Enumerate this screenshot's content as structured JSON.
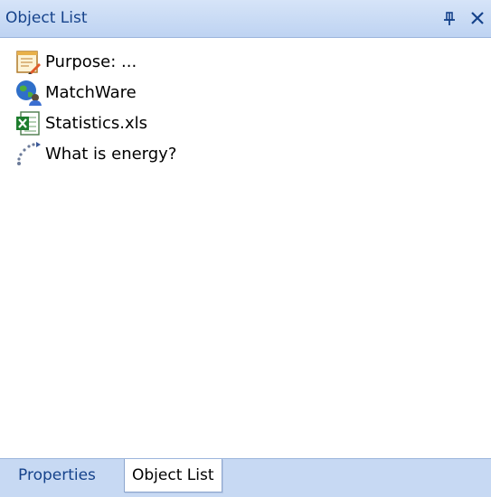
{
  "panel": {
    "title": "Object List",
    "pin_icon": "pin-icon",
    "close_icon": "close-icon"
  },
  "items": [
    {
      "label": "Purpose: ...",
      "icon": "form-document-icon"
    },
    {
      "label": "MatchWare",
      "icon": "globe-user-icon"
    },
    {
      "label": "Statistics.xls",
      "icon": "excel-document-icon"
    },
    {
      "label": "What is energy?",
      "icon": "dotted-path-icon"
    }
  ],
  "tabs": [
    {
      "label": "Properties",
      "active": false
    },
    {
      "label": "Object List",
      "active": true
    }
  ],
  "colors": {
    "title_bar": "#c4d7f4",
    "title_text": "#15428b",
    "tab_bar": "#c7d9f3"
  }
}
